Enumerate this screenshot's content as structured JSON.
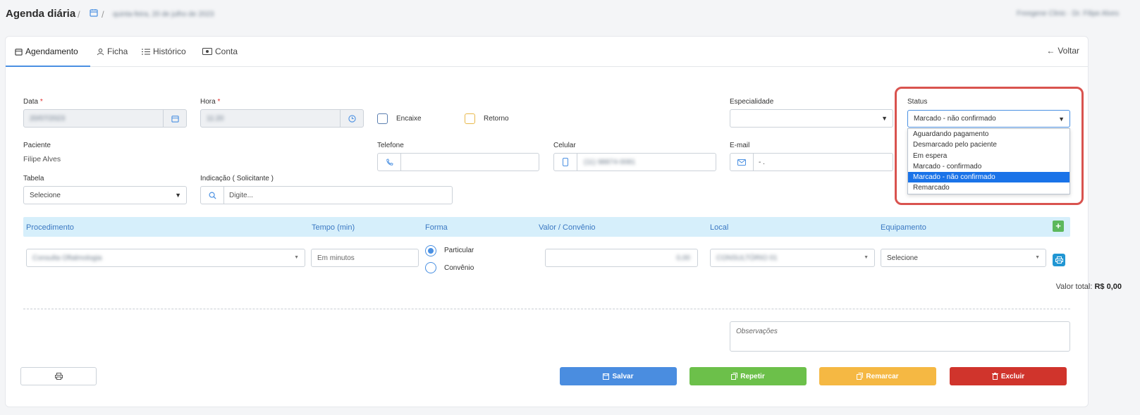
{
  "header": {
    "title": "Agenda diária",
    "separator": "/",
    "date_crumb": "quinta-feira, 20 de julho de 2023",
    "clinic_user": "Freegene Clinic · Dr. Filipe Alves"
  },
  "tabs": [
    {
      "label": "Agendamento"
    },
    {
      "label": "Ficha"
    },
    {
      "label": "Histórico"
    },
    {
      "label": "Conta"
    }
  ],
  "back_label": "Voltar",
  "form": {
    "data_label": "Data",
    "data_value": "20/07/2023",
    "hora_label": "Hora",
    "hora_value": "11:20",
    "required_mark": "*",
    "encaixe_label": "Encaixe",
    "retorno_label": "Retorno",
    "especialidade_label": "Especialidade",
    "especialidade_value": "",
    "status_label": "Status",
    "status_value": "Marcado - não confirmado",
    "status_options": [
      "Aguardando pagamento",
      "Desmarcado pelo paciente",
      "Em espera",
      "Marcado - confirmado",
      "Marcado - não confirmado",
      "Remarcado"
    ],
    "paciente_label": "Paciente",
    "paciente_value": "Filipe Alves",
    "telefone_label": "Telefone",
    "telefone_value": "",
    "celular_label": "Celular",
    "celular_value": "(11) 98874-0081",
    "email_label": "E-mail",
    "email_value": "- .",
    "tabela_label": "Tabela",
    "tabela_value": "Selecione",
    "indicacao_label": "Indicação ( Solicitante )",
    "indicacao_placeholder": "Digite..."
  },
  "procedures": {
    "headers": [
      "Procedimento",
      "Tempo (min)",
      "Forma",
      "Valor / Convênio",
      "Local",
      "Equipamento"
    ],
    "row": {
      "procedimento": "Consulta Oftalmologia",
      "tempo_placeholder": "Em minutos",
      "forma_options": [
        "Particular",
        "Convênio"
      ],
      "valor": "0,00",
      "local": "CONSULTÓRIO 01",
      "equipamento": "Selecione"
    },
    "total_label": "Valor total:",
    "total_value": "R$ 0,00"
  },
  "observacoes_placeholder": "Observações",
  "buttons": {
    "save": "Salvar",
    "repeat": "Repetir",
    "remark": "Remarcar",
    "delete": "Excluir"
  },
  "colors": {
    "accent": "#4a90e2",
    "save": "#4a8de0",
    "repeat": "#6cc04a",
    "remark": "#f5b843",
    "delete": "#d0342c",
    "highlight": "#d9534f"
  }
}
